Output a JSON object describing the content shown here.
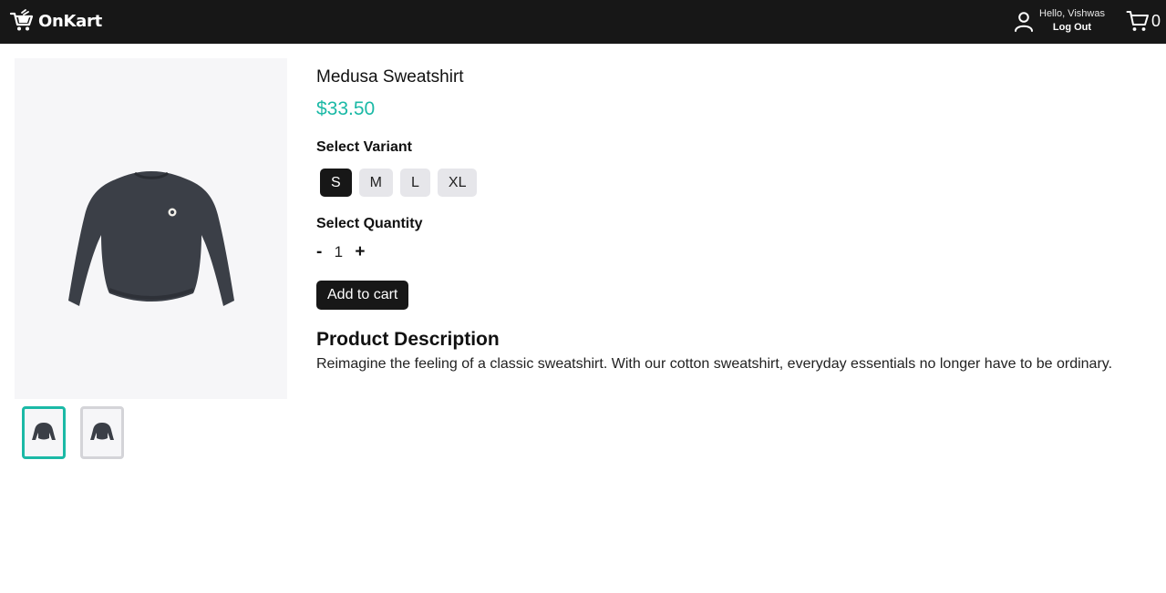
{
  "header": {
    "brand": "OnKart",
    "greeting": "Hello, Vishwas",
    "logout_label": "Log Out",
    "cart_count": "0",
    "background": "#171717"
  },
  "gallery": {
    "thumbnails": [
      {
        "state": "active"
      },
      {
        "state": "inactive"
      }
    ]
  },
  "product": {
    "title": "Medusa Sweatshirt",
    "price": "$33.50",
    "variant_label": "Select Variant",
    "variants": [
      {
        "label": "S",
        "selected": true
      },
      {
        "label": "M",
        "selected": false
      },
      {
        "label": "L",
        "selected": false
      },
      {
        "label": "XL",
        "selected": false
      }
    ],
    "quantity_label": "Select Quantity",
    "decrement_label": "-",
    "quantity": "1",
    "increment_label": "+",
    "add_to_cart_label": "Add to cart",
    "description_title": "Product Description",
    "description": "Reimagine the feeling of a classic sweatshirt. With our cotton sweatshirt, everyday essentials no longer have to be ordinary."
  },
  "colors": {
    "accent": "#1bb9a6",
    "dark": "#171717",
    "chip": "#e6e6ea"
  },
  "icons": {
    "brand": "shopping-cart-logo-icon",
    "user": "user-icon",
    "cart": "cart-icon"
  }
}
